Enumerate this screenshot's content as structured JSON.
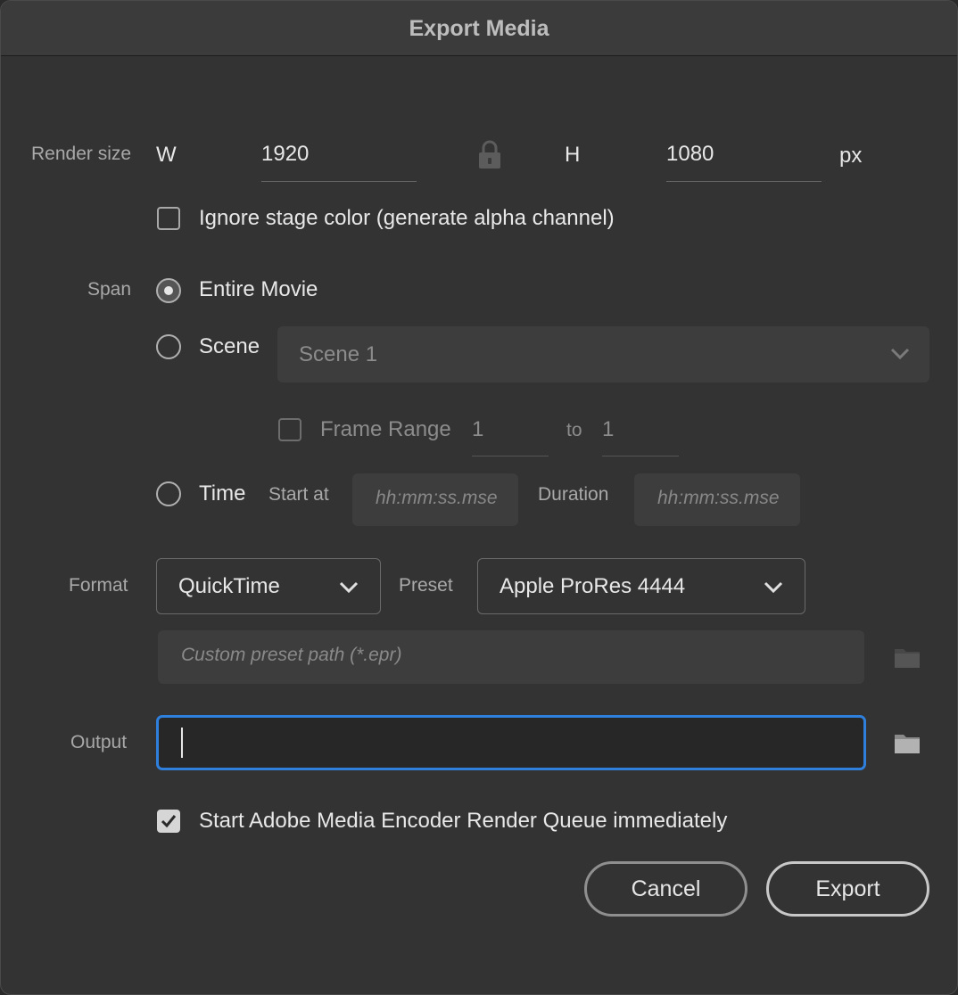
{
  "window": {
    "title": "Export Media"
  },
  "render_size": {
    "label": "Render size",
    "width_label": "W",
    "width_value": "1920",
    "height_label": "H",
    "height_value": "1080",
    "unit": "px",
    "lock_icon": "lock-icon"
  },
  "alpha_option": {
    "label": "Ignore stage color (generate alpha channel)",
    "checked": false
  },
  "span": {
    "label": "Span",
    "entire_movie": {
      "label": "Entire Movie",
      "selected": true
    },
    "scene": {
      "label": "Scene",
      "selected": false,
      "dropdown_value": "Scene 1"
    },
    "frame_range": {
      "label": "Frame Range",
      "checked": false,
      "from": "1",
      "to_label": "to",
      "to": "1"
    },
    "time": {
      "label": "Time",
      "selected": false,
      "start_label": "Start at",
      "start_placeholder": "hh:mm:ss.mse",
      "duration_label": "Duration",
      "duration_placeholder": "hh:mm:ss.mse"
    }
  },
  "format": {
    "label": "Format",
    "value": "QuickTime",
    "preset_label": "Preset",
    "preset_value": "Apple ProRes 4444",
    "custom_preset_placeholder": "Custom preset path (*.epr)"
  },
  "output": {
    "label": "Output",
    "value": ""
  },
  "queue_option": {
    "label": "Start Adobe Media Encoder Render Queue immediately",
    "checked": true
  },
  "buttons": {
    "cancel": "Cancel",
    "export": "Export"
  },
  "colors": {
    "accent_focus": "#2f7fdd",
    "dialog_bg": "#333333"
  }
}
